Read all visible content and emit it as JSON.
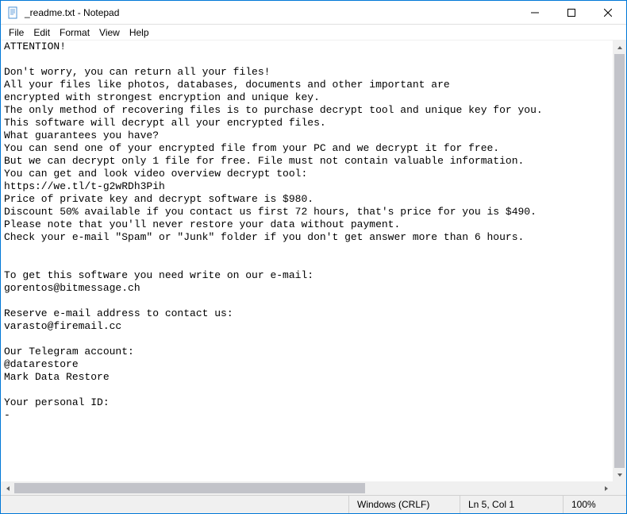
{
  "window": {
    "title": "_readme.txt - Notepad"
  },
  "menu": {
    "file": "File",
    "edit": "Edit",
    "format": "Format",
    "view": "View",
    "help": "Help"
  },
  "body_text": "ATTENTION!\n\nDon't worry, you can return all your files!\nAll your files like photos, databases, documents and other important are\nencrypted with strongest encryption and unique key.\nThe only method of recovering files is to purchase decrypt tool and unique key for you.\nThis software will decrypt all your encrypted files.\nWhat guarantees you have?\nYou can send one of your encrypted file from your PC and we decrypt it for free.\nBut we can decrypt only 1 file for free. File must not contain valuable information.\nYou can get and look video overview decrypt tool:\nhttps://we.tl/t-g2wRDh3Pih\nPrice of private key and decrypt software is $980.\nDiscount 50% available if you contact us first 72 hours, that's price for you is $490.\nPlease note that you'll never restore your data without payment.\nCheck your e-mail \"Spam\" or \"Junk\" folder if you don't get answer more than 6 hours.\n\n\nTo get this software you need write on our e-mail:\ngorentos@bitmessage.ch\n\nReserve e-mail address to contact us:\nvarasto@firemail.cc\n\nOur Telegram account:\n@datarestore\nMark Data Restore\n\nYour personal ID:\n-",
  "status": {
    "encoding": "Windows (CRLF)",
    "position": "Ln 5, Col 1",
    "zoom": "100%"
  }
}
